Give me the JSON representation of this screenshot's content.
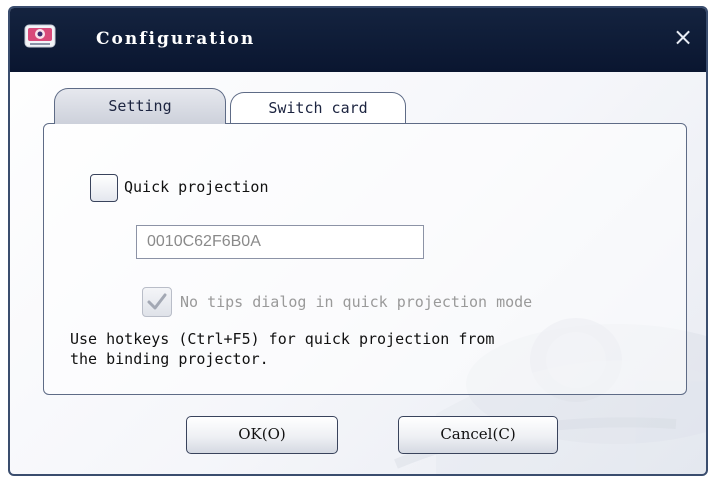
{
  "window": {
    "title": "Configuration",
    "close_glyph": "×",
    "icon": "projector-app-icon"
  },
  "tabs": [
    {
      "label": "Setting",
      "active": true
    },
    {
      "label": "Switch card",
      "active": false
    }
  ],
  "setting": {
    "quick_projection": {
      "label": "Quick projection",
      "checked": false
    },
    "mac_field": {
      "value": "0010C62F6B0A",
      "disabled": true
    },
    "no_tips": {
      "label": "No tips dialog in quick projection mode",
      "checked": true,
      "disabled": true
    },
    "hint": "Use hotkeys (Ctrl+F5) for quick projection from\nthe binding projector."
  },
  "buttons": {
    "ok": "OK(O)",
    "cancel": "Cancel(C)"
  },
  "colors": {
    "titlebar": "#0a1630",
    "title_text": "#ffffff",
    "border": "#3a4d6e"
  }
}
